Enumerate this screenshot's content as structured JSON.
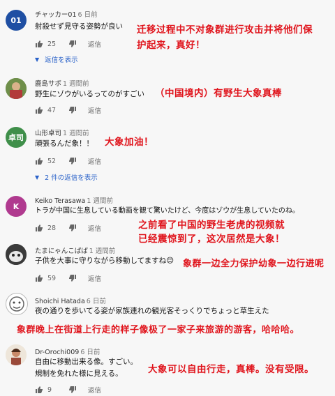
{
  "colors": {
    "annotation": "#e0141c",
    "link": "#2a62c9",
    "dim": "#777777"
  },
  "comments": [
    {
      "user": "チャッカー01",
      "time": "6 日前",
      "avatar_text": "01",
      "lines": [
        "射殺せず見守る姿勢が良い"
      ],
      "likes": "25",
      "reply_label": "返信",
      "replies_label": "返信を表示",
      "annotation": [
        "迁移过程中不对象群进行攻击并将他们保",
        "护起来，真好！"
      ]
    },
    {
      "user": "鹿島サボ",
      "time": "1 週間前",
      "avatar_text": "",
      "lines": [
        "野生にゾウがいるってのがすごい"
      ],
      "likes": "47",
      "reply_label": "返信",
      "annotation": [
        "（中国境内）有野生大象真棒"
      ]
    },
    {
      "user": "山形卓司",
      "time": "1 週間前",
      "avatar_text": "卓司",
      "lines": [
        "頑張るんだ象！！"
      ],
      "likes": "52",
      "reply_label": "返信",
      "replies_label": "2 件の返信を表示",
      "annotation": [
        "大象加油！"
      ]
    },
    {
      "user": "Keiko Terasawa",
      "time": "1 週間前",
      "avatar_text": "K",
      "lines": [
        "トラが中国に生息している動画を観て驚いたけど、今度はゾウが生息していたのね。"
      ],
      "likes": "28",
      "reply_label": "返信",
      "annotation": [
        "之前看了中国的野生老虎的视频就",
        "已经震惊到了，这次居然是大象！"
      ]
    },
    {
      "user": "たまにゃんこぱぱ",
      "time": "1 週間前",
      "avatar_text": "",
      "lines": [
        "子供を大事に守りながら移動してますね😊"
      ],
      "likes": "59",
      "reply_label": "返信",
      "annotation": [
        "象群一边全力保护幼象一边行进呢"
      ]
    },
    {
      "user": "Shoichi Hatada",
      "time": "6 日前",
      "avatar_text": "",
      "lines": [
        "夜の通りを歩いてる姿が家族連れの観光客そっくりでちょっと草生えた"
      ],
      "likes": "",
      "reply_label": "",
      "annotation": [
        "象群晚上在街道上行走的样子像极了一家子来旅游的游客，哈哈哈。"
      ]
    },
    {
      "user": "Dr-Orochi009",
      "time": "6 日前",
      "avatar_text": "",
      "lines": [
        "自由に移動出来る像。すごい。",
        "規制を免れた様に見える。"
      ],
      "likes": "9",
      "reply_label": "返信",
      "annotation": [
        "大象可以自由行走，真棒。没有受限。"
      ]
    }
  ]
}
